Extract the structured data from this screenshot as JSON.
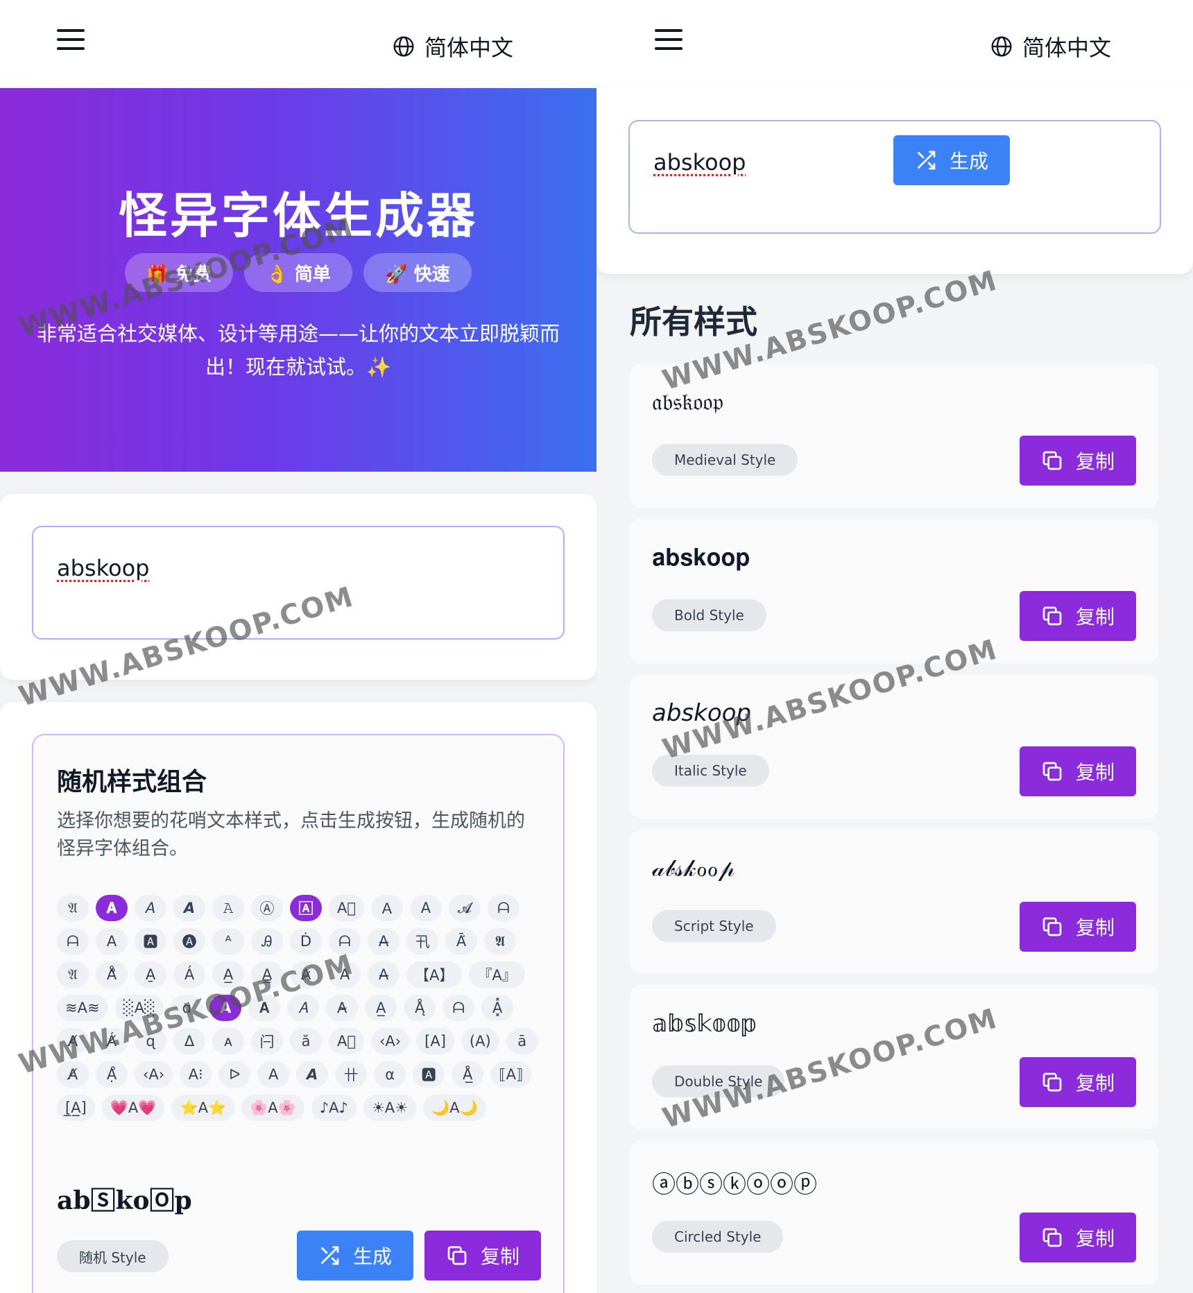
{
  "header": {
    "language": "简体中文"
  },
  "hero": {
    "title": "怪异字体生成器",
    "badges": [
      "🎁 免费",
      "👌 简单",
      "🚀 快速"
    ],
    "description": "非常适合社交媒体、设计等用途——让你的文本立即脱颖而出！现在就试试。✨"
  },
  "input": {
    "value": "abskoop"
  },
  "random_section": {
    "title": "随机样式组合",
    "description": "选择你想要的花哨文本样式，点击生成按钮，生成随机的怪异字体组合。",
    "chips": [
      {
        "t": "𝔄",
        "a": false
      },
      {
        "t": "𝐀",
        "a": true
      },
      {
        "t": "𝘈",
        "a": false
      },
      {
        "t": "𝘼",
        "a": false
      },
      {
        "t": "𝙰",
        "a": false
      },
      {
        "t": "Ⓐ",
        "a": false
      },
      {
        "t": "🄰",
        "a": true
      },
      {
        "t": "A⃞",
        "a": false
      },
      {
        "t": "Ａ",
        "a": false
      },
      {
        "t": "𝖠",
        "a": false
      },
      {
        "t": "𝓐",
        "a": false
      },
      {
        "t": "ᗩ",
        "a": false
      },
      {
        "t": "ᗩ",
        "a": false
      },
      {
        "t": "A",
        "a": false
      },
      {
        "t": "🅰",
        "a": false
      },
      {
        "t": "🅐",
        "a": false
      },
      {
        "t": "ᴬ",
        "a": false
      },
      {
        "t": "Ꭿ",
        "a": false
      },
      {
        "t": "Ḋ",
        "a": false
      },
      {
        "t": "ᗩ",
        "a": false
      },
      {
        "t": "A̶",
        "a": false
      },
      {
        "t": "卂",
        "a": false
      },
      {
        "t": "Ā̈",
        "a": false
      },
      {
        "t": "𝕬",
        "a": false
      },
      {
        "t": "𝔄",
        "a": false
      },
      {
        "t": "Å̊",
        "a": false
      },
      {
        "t": "A̱",
        "a": false
      },
      {
        "t": "Á",
        "a": false
      },
      {
        "t": "A̲",
        "a": false
      },
      {
        "t": "A̳",
        "a": false
      },
      {
        "t": "A̷",
        "a": false
      },
      {
        "t": "A̵",
        "a": false
      },
      {
        "t": "A̶",
        "a": false
      },
      {
        "t": "【A】",
        "a": false
      },
      {
        "t": "『A』",
        "a": false
      },
      {
        "t": "≋A≋",
        "a": false
      },
      {
        "t": "░A░",
        "a": false
      },
      {
        "t": "ɑ",
        "a": false
      },
      {
        "t": "A",
        "a": true
      },
      {
        "t": "𝐀",
        "a": false
      },
      {
        "t": "𝐴",
        "a": false
      },
      {
        "t": "A̴",
        "a": false
      },
      {
        "t": "A̲",
        "a": false
      },
      {
        "t": "Ą̊",
        "a": false
      },
      {
        "t": "ᗩ",
        "a": false
      },
      {
        "t": "A͓̽",
        "a": false
      },
      {
        "t": "A̸",
        "a": false
      },
      {
        "t": "Á̸",
        "a": false
      },
      {
        "t": "ɋ",
        "a": false
      },
      {
        "t": "Δ",
        "a": false
      },
      {
        "t": "ᴀ",
        "a": false
      },
      {
        "t": "闩",
        "a": false
      },
      {
        "t": "ă",
        "a": false
      },
      {
        "t": "A⃨",
        "a": false
      },
      {
        "t": "‹A›",
        "a": false
      },
      {
        "t": "[A]",
        "a": false
      },
      {
        "t": "(A)",
        "a": false
      },
      {
        "t": "ā",
        "a": false
      },
      {
        "t": "A̸",
        "a": false
      },
      {
        "t": "Ạ̊",
        "a": false
      },
      {
        "t": "‹A›",
        "a": false
      },
      {
        "t": "A⁝",
        "a": false
      },
      {
        "t": "ᐅ",
        "a": false
      },
      {
        "t": "A",
        "a": false
      },
      {
        "t": "𝘼",
        "a": false
      },
      {
        "t": "卄",
        "a": false
      },
      {
        "t": "α",
        "a": false
      },
      {
        "t": "🅰",
        "a": false
      },
      {
        "t": "Å̲",
        "a": false
      },
      {
        "t": "⟦A⟧",
        "a": false
      },
      {
        "t": "[̲A̲]",
        "a": false
      },
      {
        "t": "💗A💗",
        "a": false
      },
      {
        "t": "⭐A⭐",
        "a": false
      },
      {
        "t": "🌸A🌸",
        "a": false
      },
      {
        "t": "♪A♪",
        "a": false
      },
      {
        "t": "☀A☀",
        "a": false
      },
      {
        "t": "🌙A🌙",
        "a": false
      }
    ],
    "result": "ab🅂ko🄾p",
    "style_label": "随机 Style",
    "generate_label": "生成",
    "copy_label": "复制"
  },
  "right_input": {
    "value": "abskoop",
    "generate_label": "生成"
  },
  "all_styles": {
    "title": "所有样式",
    "copy_label": "复制",
    "items": [
      {
        "sample": "𝔞𝔟𝔰𝔨𝔬𝔬𝔭",
        "label": "Medieval Style"
      },
      {
        "sample": "𝐚𝐛𝐬𝐤𝐨𝐨𝐩",
        "label": "Bold Style"
      },
      {
        "sample": "𝘢𝘣𝘴𝘬𝘰𝘰𝘱",
        "label": "Italic Style"
      },
      {
        "sample": "𝒶𝒷𝓈𝓀ℴℴ𝓅",
        "label": "Script Style"
      },
      {
        "sample": "𝕒𝕓𝕤𝕜𝕠𝕠𝕡",
        "label": "Double Style"
      },
      {
        "sample": "ⓐⓑⓢⓚⓞⓞⓟ",
        "label": "Circled Style"
      }
    ]
  },
  "watermark": "WWW.ABSKOOP.COM",
  "colors": {
    "purple": "#8b2bdc",
    "blue": "#3b82f6",
    "hero_start": "#8b2bdc",
    "hero_end": "#3b6ff1"
  }
}
